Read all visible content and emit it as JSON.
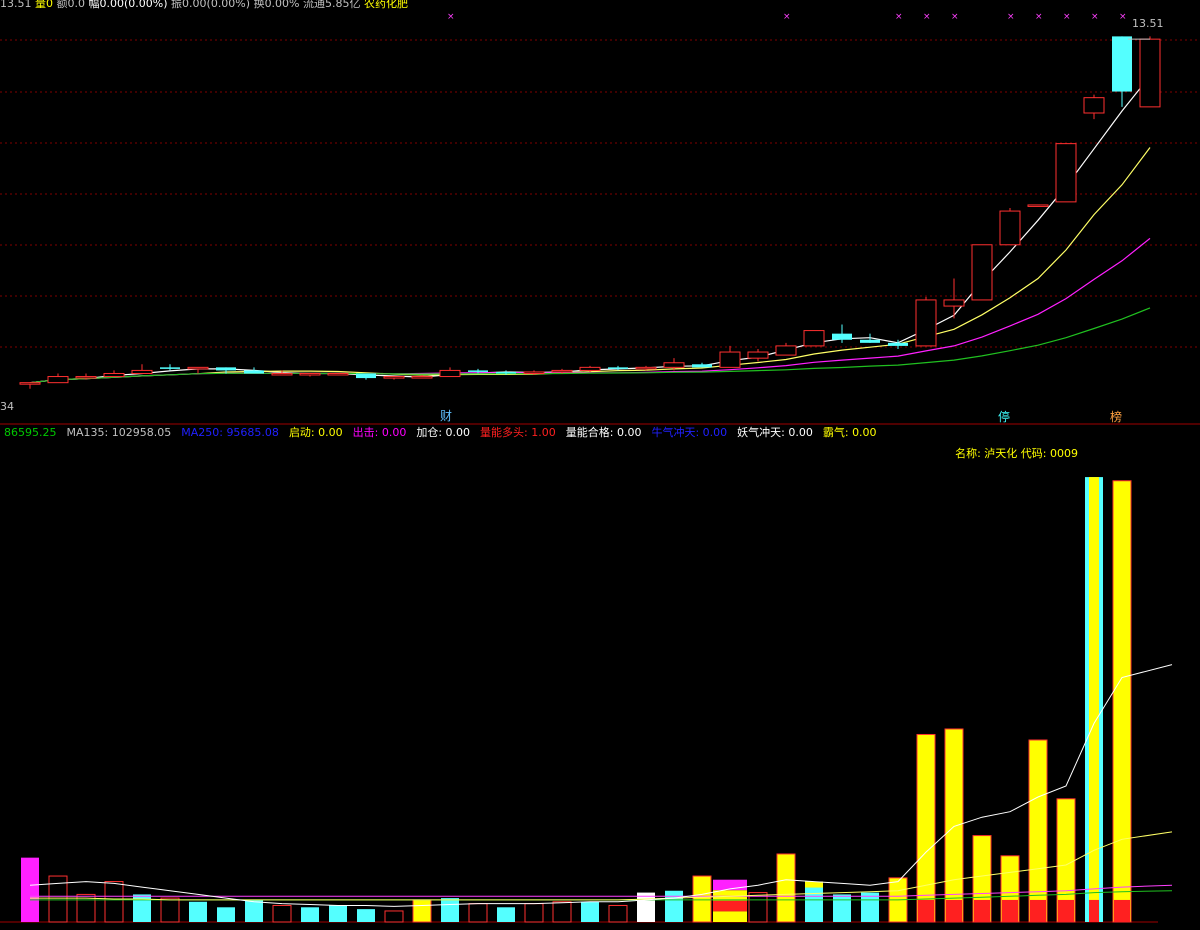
{
  "header": {
    "last": "13.51",
    "vol_label": "量",
    "vol_value": "0",
    "amt_label": "额",
    "amt_value": "0.0",
    "chg_label": "幅",
    "chg_value": "0.00(0.00%)",
    "amp_label": "振",
    "amp_value": "0.00(0.00%)",
    "turn_label": "换",
    "turn_value": "0.00%",
    "float_label": "流通",
    "float_value": "5.85亿",
    "sector": "农药化肥"
  },
  "price_panel": {
    "right_price": "13.51",
    "left_low": "34",
    "event_labels": [
      "财",
      "停",
      "榜"
    ],
    "price_range": [
      1.8,
      14.2
    ],
    "candles": [
      {
        "o": 2.3,
        "h": 2.3,
        "l": 2.1,
        "c": 2.3
      },
      {
        "o": 2.3,
        "h": 2.6,
        "l": 2.3,
        "c": 2.5
      },
      {
        "o": 2.5,
        "h": 2.6,
        "l": 2.4,
        "c": 2.5
      },
      {
        "o": 2.5,
        "h": 2.7,
        "l": 2.5,
        "c": 2.6
      },
      {
        "o": 2.6,
        "h": 2.9,
        "l": 2.6,
        "c": 2.7
      },
      {
        "o": 2.8,
        "h": 2.9,
        "l": 2.7,
        "c": 2.75
      },
      {
        "o": 2.75,
        "h": 2.8,
        "l": 2.6,
        "c": 2.8
      },
      {
        "o": 2.8,
        "h": 2.8,
        "l": 2.6,
        "c": 2.7
      },
      {
        "o": 2.7,
        "h": 2.8,
        "l": 2.6,
        "c": 2.6
      },
      {
        "o": 2.6,
        "h": 2.7,
        "l": 2.6,
        "c": 2.6
      },
      {
        "o": 2.6,
        "h": 2.6,
        "l": 2.5,
        "c": 2.6
      },
      {
        "o": 2.6,
        "h": 2.6,
        "l": 2.55,
        "c": 2.6
      },
      {
        "o": 2.6,
        "h": 2.6,
        "l": 2.4,
        "c": 2.45
      },
      {
        "o": 2.45,
        "h": 2.5,
        "l": 2.4,
        "c": 2.5
      },
      {
        "o": 2.5,
        "h": 2.55,
        "l": 2.45,
        "c": 2.5
      },
      {
        "o": 2.5,
        "h": 2.8,
        "l": 2.5,
        "c": 2.7
      },
      {
        "o": 2.7,
        "h": 2.75,
        "l": 2.6,
        "c": 2.65
      },
      {
        "o": 2.65,
        "h": 2.7,
        "l": 2.55,
        "c": 2.6
      },
      {
        "o": 2.6,
        "h": 2.7,
        "l": 2.55,
        "c": 2.65
      },
      {
        "o": 2.65,
        "h": 2.75,
        "l": 2.6,
        "c": 2.7
      },
      {
        "o": 2.7,
        "h": 2.85,
        "l": 2.65,
        "c": 2.8
      },
      {
        "o": 2.8,
        "h": 2.85,
        "l": 2.7,
        "c": 2.75
      },
      {
        "o": 2.75,
        "h": 2.85,
        "l": 2.7,
        "c": 2.8
      },
      {
        "o": 2.8,
        "h": 3.1,
        "l": 2.7,
        "c": 2.95
      },
      {
        "o": 2.9,
        "h": 2.95,
        "l": 2.8,
        "c": 2.8
      },
      {
        "o": 2.8,
        "h": 3.5,
        "l": 2.8,
        "c": 3.3
      },
      {
        "o": 3.1,
        "h": 3.4,
        "l": 3.0,
        "c": 3.3
      },
      {
        "o": 3.2,
        "h": 3.6,
        "l": 3.2,
        "c": 3.5
      },
      {
        "o": 3.5,
        "h": 4.0,
        "l": 3.5,
        "c": 4.0
      },
      {
        "o": 3.9,
        "h": 4.2,
        "l": 3.6,
        "c": 3.7
      },
      {
        "o": 3.7,
        "h": 3.9,
        "l": 3.6,
        "c": 3.6
      },
      {
        "o": 3.6,
        "h": 3.7,
        "l": 3.4,
        "c": 3.5
      },
      {
        "o": 3.5,
        "h": 5.1,
        "l": 3.5,
        "c": 5.0
      },
      {
        "o": 4.8,
        "h": 5.7,
        "l": 4.4,
        "c": 5.0
      },
      {
        "o": 5.0,
        "h": 6.8,
        "l": 5.0,
        "c": 6.8
      },
      {
        "o": 6.8,
        "h": 8.0,
        "l": 6.8,
        "c": 7.9
      },
      {
        "o": 8.1,
        "h": 8.1,
        "l": 8.1,
        "c": 8.1
      },
      {
        "o": 8.2,
        "h": 10.1,
        "l": 8.2,
        "c": 10.1
      },
      {
        "o": 11.1,
        "h": 11.7,
        "l": 10.9,
        "c": 11.6
      },
      {
        "o": 13.6,
        "h": 13.6,
        "l": 11.3,
        "c": 11.8
      },
      {
        "o": 11.3,
        "h": 13.6,
        "l": 11.3,
        "c": 13.51
      }
    ]
  },
  "indicator_bar": {
    "items": [
      {
        "label": "",
        "value": "86595.25",
        "color": "#00c800"
      },
      {
        "label": "MA135: ",
        "value": "102958.05",
        "color": "#c0c0c0"
      },
      {
        "label": "MA250: ",
        "value": "95685.08",
        "color": "#2020ff"
      },
      {
        "label": "启动: ",
        "value": "0.00",
        "color": "#ffff00"
      },
      {
        "label": "出击: ",
        "value": "0.00",
        "color": "#ff00ff"
      },
      {
        "label": "加仓: ",
        "value": "0.00",
        "color": "#ffffff"
      },
      {
        "label": "量能多头: ",
        "value": "1.00",
        "color": "#ff2020"
      },
      {
        "label": "量能合格: ",
        "value": "0.00",
        "color": "#ffffff"
      },
      {
        "label": "牛气冲天: ",
        "value": "0.00",
        "color": "#2020ff"
      },
      {
        "label": "妖气冲天: ",
        "value": "0.00",
        "color": "#ffffff"
      },
      {
        "label": "霸气: ",
        "value": "0.00",
        "color": "#ffff00"
      }
    ],
    "stock_name_label": "名称: ",
    "stock_name": "泸天化",
    "code_label": " 代码: ",
    "code": "0009"
  },
  "volume_panel": {
    "vol_max": 260000,
    "bars": [
      {
        "v": 35000,
        "t": "m"
      },
      {
        "v": 25000,
        "t": "r"
      },
      {
        "v": 15000,
        "t": "r"
      },
      {
        "v": 22000,
        "t": "r"
      },
      {
        "v": 15000,
        "t": "c"
      },
      {
        "v": 13000,
        "t": "r"
      },
      {
        "v": 11000,
        "t": "c"
      },
      {
        "v": 8000,
        "t": "c"
      },
      {
        "v": 12000,
        "t": "c"
      },
      {
        "v": 9000,
        "t": "r"
      },
      {
        "v": 8000,
        "t": "c"
      },
      {
        "v": 9000,
        "t": "c"
      },
      {
        "v": 7000,
        "t": "c"
      },
      {
        "v": 6000,
        "t": "r"
      },
      {
        "v": 12000,
        "t": "y"
      },
      {
        "v": 13000,
        "t": "c"
      },
      {
        "v": 10000,
        "t": "r"
      },
      {
        "v": 8000,
        "t": "c"
      },
      {
        "v": 10000,
        "t": "r"
      },
      {
        "v": 11000,
        "t": "r"
      },
      {
        "v": 11000,
        "t": "c"
      },
      {
        "v": 9000,
        "t": "r"
      },
      {
        "v": 16000,
        "t": "w"
      },
      {
        "v": 17000,
        "t": "c"
      },
      {
        "v": 25000,
        "t": "y"
      },
      {
        "v": 23000,
        "t": "pr"
      },
      {
        "v": 16000,
        "t": "r"
      },
      {
        "v": 37000,
        "t": "y"
      },
      {
        "v": 22000,
        "t": "yc"
      },
      {
        "v": 15000,
        "t": "c"
      },
      {
        "v": 16000,
        "t": "c"
      },
      {
        "v": 24000,
        "t": "y"
      },
      {
        "v": 102000,
        "t": "yr"
      },
      {
        "v": 105000,
        "t": "yr"
      },
      {
        "v": 47000,
        "t": "yr"
      },
      {
        "v": 36000,
        "t": "yr"
      },
      {
        "v": 99000,
        "t": "yr"
      },
      {
        "v": 67000,
        "t": "yr"
      },
      {
        "v": 242000,
        "t": "cy"
      },
      {
        "v": 240000,
        "t": "yr"
      }
    ],
    "ma5": [
      20000,
      21000,
      22000,
      21000,
      19000,
      17000,
      15000,
      13000,
      11000,
      10000,
      9500,
      9000,
      9000,
      8500,
      9000,
      9500,
      10000,
      10000,
      10000,
      10500,
      11000,
      11000,
      12000,
      13000,
      15000,
      18000,
      20000,
      23000,
      22000,
      21000,
      20000,
      22000,
      38000,
      52000,
      57000,
      60000,
      68000,
      74000,
      108000,
      133000,
      140000
    ],
    "ma10": [
      13000,
      13000,
      13000,
      12500,
      12500,
      12000,
      12000,
      12000,
      12000,
      12000,
      12000,
      12000,
      12000,
      12000,
      12000,
      12000,
      12000,
      12000,
      12000,
      12000,
      12000,
      12000,
      12500,
      13000,
      13500,
      14000,
      14500,
      15000,
      15500,
      16000,
      16500,
      17000,
      20000,
      23000,
      25000,
      27000,
      29000,
      31000,
      39000,
      45000,
      49000
    ],
    "ma_long_a": [
      14000,
      14000,
      14000,
      14000,
      14000,
      14000,
      14000,
      14000,
      14000,
      14000,
      14000,
      14000,
      14000,
      14000,
      14000,
      14000,
      14000,
      14000,
      14000,
      14000,
      14000,
      14000,
      14000,
      14000,
      14000,
      14000,
      14000,
      14000,
      14000,
      14000,
      14000,
      14000,
      14500,
      15000,
      15500,
      16000,
      16500,
      17000,
      18000,
      19000,
      20000
    ],
    "ma_long_b": [
      12000,
      12000,
      12000,
      12000,
      12000,
      12000,
      12000,
      12000,
      12000,
      12000,
      12000,
      12000,
      12000,
      12000,
      12000,
      12000,
      12000,
      12000,
      12000,
      12000,
      12000,
      12000,
      12000,
      12000,
      12000,
      12000,
      12000,
      12000,
      12000,
      12000,
      12000,
      12000,
      12500,
      13000,
      13500,
      14000,
      14500,
      15000,
      16000,
      16500,
      17000
    ]
  }
}
